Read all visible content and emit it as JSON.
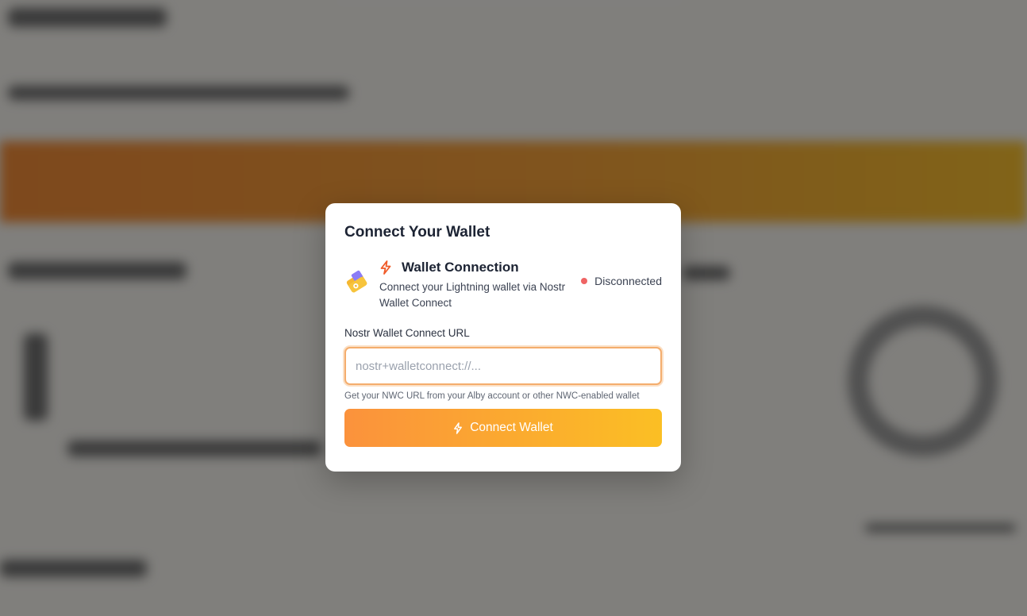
{
  "modal": {
    "title": "Connect Your Wallet",
    "connection": {
      "title": "Wallet Connection",
      "description": "Connect your Lightning wallet via Nostr Wallet Connect",
      "status": "Disconnected",
      "status_color": "#ef6464"
    },
    "nwc_field": {
      "label": "Nostr Wallet Connect URL",
      "value": "",
      "placeholder": "nostr+walletconnect://...",
      "hint": "Get your NWC URL from your Alby account or other NWC-enabled wallet"
    },
    "connect_button": {
      "label": "Connect Wallet"
    }
  },
  "colors": {
    "accent_start": "#fb923c",
    "accent_end": "#fbbf24",
    "bolt": "#f05a28"
  },
  "icons": {
    "wallet": "wallet-plug-icon",
    "bolt": "lightning-bolt-icon"
  }
}
